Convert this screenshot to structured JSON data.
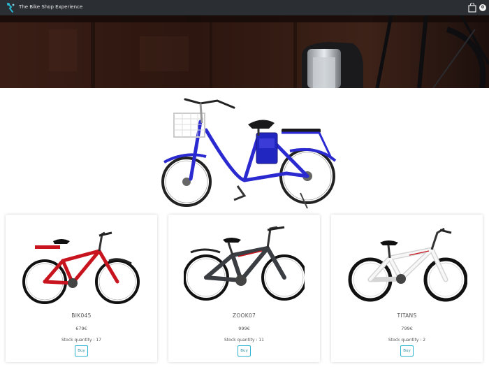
{
  "navbar": {
    "brand": "The Bike Shop Experience",
    "cart_count": "0",
    "accent": "#2ab4cf"
  },
  "products": [
    {
      "name": "BIK045",
      "price": "679€",
      "stock": "Stock quantity : 17",
      "buy_label": "Buy",
      "frame_color": "#c8141e"
    },
    {
      "name": "ZOOK07",
      "price": "999€",
      "stock": "Stock quantity : 11",
      "buy_label": "Buy",
      "frame_color": "#3a3d42"
    },
    {
      "name": "TITANS",
      "price": "799€",
      "stock": "Stock quantity : 2",
      "buy_label": "Buy",
      "frame_color": "#f4f4f4"
    }
  ],
  "featured": {
    "frame_color": "#2a2ad0"
  },
  "icons": {
    "logo": "wrench-bike-logo-icon",
    "cart": "shopping-bag-icon"
  }
}
